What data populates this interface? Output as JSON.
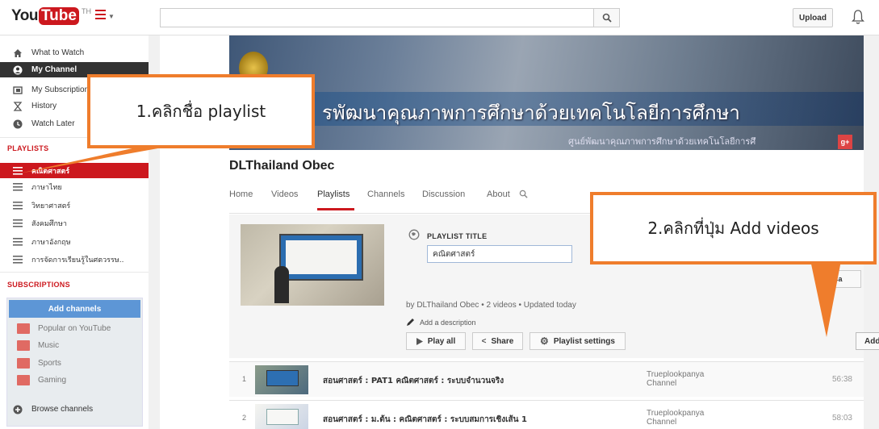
{
  "header": {
    "logo_you": "You",
    "logo_tube": "Tube",
    "logo_region": "TH",
    "search_placeholder": "",
    "upload_label": "Upload"
  },
  "sidebar": {
    "nav": [
      {
        "label": "What to Watch",
        "icon": "home-icon"
      },
      {
        "label": "My Channel",
        "icon": "user-icon"
      },
      {
        "label": "My Subscriptions",
        "icon": "subscriptions-icon"
      },
      {
        "label": "History",
        "icon": "hourglass-icon"
      },
      {
        "label": "Watch Later",
        "icon": "clock-icon"
      }
    ],
    "playlists_title": "PLAYLISTS",
    "playlists": [
      {
        "label": "คณิตศาสตร์"
      },
      {
        "label": "ภาษาไทย"
      },
      {
        "label": "วิทยาศาสตร์"
      },
      {
        "label": "สังคมศึกษา"
      },
      {
        "label": "ภาษาอังกฤษ"
      },
      {
        "label": "การจัดการเรียนรู้ในศตวรรษ.."
      }
    ],
    "subscriptions_title": "SUBSCRIPTIONS",
    "add_channels_label": "Add channels",
    "subscriptions": [
      {
        "label": "Popular on YouTube"
      },
      {
        "label": "Music"
      },
      {
        "label": "Sports"
      },
      {
        "label": "Gaming"
      }
    ],
    "browse_channels_label": "Browse channels"
  },
  "channel": {
    "banner_text": "รพัฒนาคุณภาพการศึกษาด้วยเทคโนโลยีการศึกษา",
    "banner_subtext": "ศูนย์พัฒนาคุณภาพการศึกษาด้วยเทคโนโลยีการศึ",
    "name": "DLThailand Obec",
    "tabs": [
      "Home",
      "Videos",
      "Playlists",
      "Channels",
      "Discussion",
      "About"
    ],
    "active_tab": "Playlists"
  },
  "playlist": {
    "title_label": "PLAYLIST TITLE",
    "title_value": "คณิตศาสตร์",
    "cancel_label": "Ca",
    "meta": "by DLThailand Obec • 2 videos • Updated today",
    "add_description": "Add a description",
    "play_all_label": "Play all",
    "share_label": "Share",
    "settings_label": "Playlist settings",
    "add_videos_label": "Add videos"
  },
  "videos": [
    {
      "index": "1",
      "title": "สอนศาสตร์ : PAT1 คณิตศาสตร์ : ระบบจำนวนจริง",
      "owner_line1": "Trueplookpanya",
      "owner_line2": "Channel",
      "duration": "56:38"
    },
    {
      "index": "2",
      "title": "สอนศาสตร์ : ม.ต้น : คณิตศาสตร์ : ระบบสมการเชิงเส้น 1",
      "owner_line1": "Trueplookpanya",
      "owner_line2": "Channel",
      "duration": "58:03"
    }
  ],
  "annotations": {
    "step1": "1.คลิกชื่อ playlist",
    "step2": "2.คลิกที่ปุ่ม Add videos",
    "color": "#ef7d2c"
  },
  "colors": {
    "brand_red": "#cc181e",
    "add_channels_blue": "#5d96d6",
    "save_blue": "#167ac6"
  }
}
